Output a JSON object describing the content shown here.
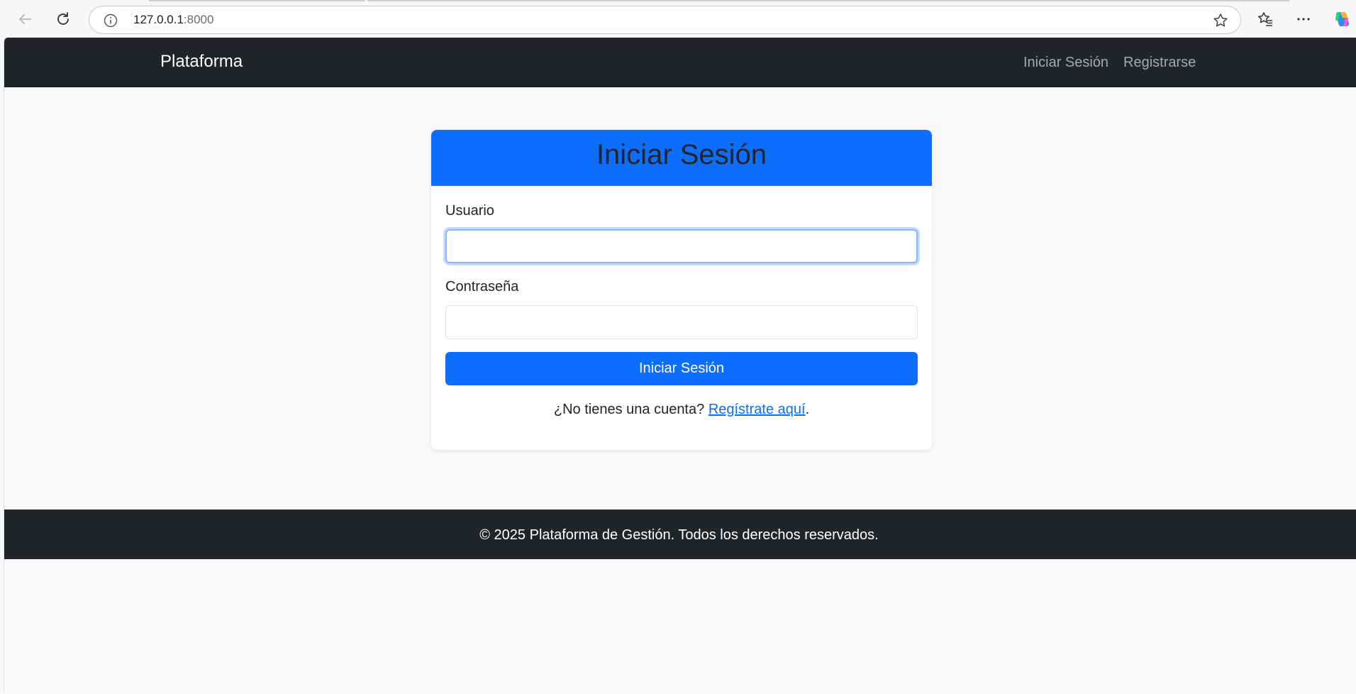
{
  "browser": {
    "url_host": "127.0.0.1",
    "url_port": ":8000",
    "icons": [
      "back-icon",
      "refresh-icon",
      "info-icon",
      "star-icon",
      "favorites-icon",
      "more-icon",
      "copilot-icon"
    ]
  },
  "navbar": {
    "brand": "Plataforma",
    "links": [
      "Iniciar Sesión",
      "Registrarse"
    ]
  },
  "login": {
    "title": "Iniciar Sesión",
    "username_label": "Usuario",
    "username_value": "",
    "password_label": "Contraseña",
    "password_value": "",
    "submit_label": "Iniciar Sesión",
    "register_prompt": "¿No tienes una cuenta?",
    "register_link": "Regístrate aquí",
    "register_suffix": "."
  },
  "footer": {
    "text": "© 2025 Plataforma de Gestión. Todos los derechos reservados."
  },
  "colors": {
    "primary": "#0d6efd",
    "dark": "#212529",
    "background": "#f8f9fa"
  }
}
